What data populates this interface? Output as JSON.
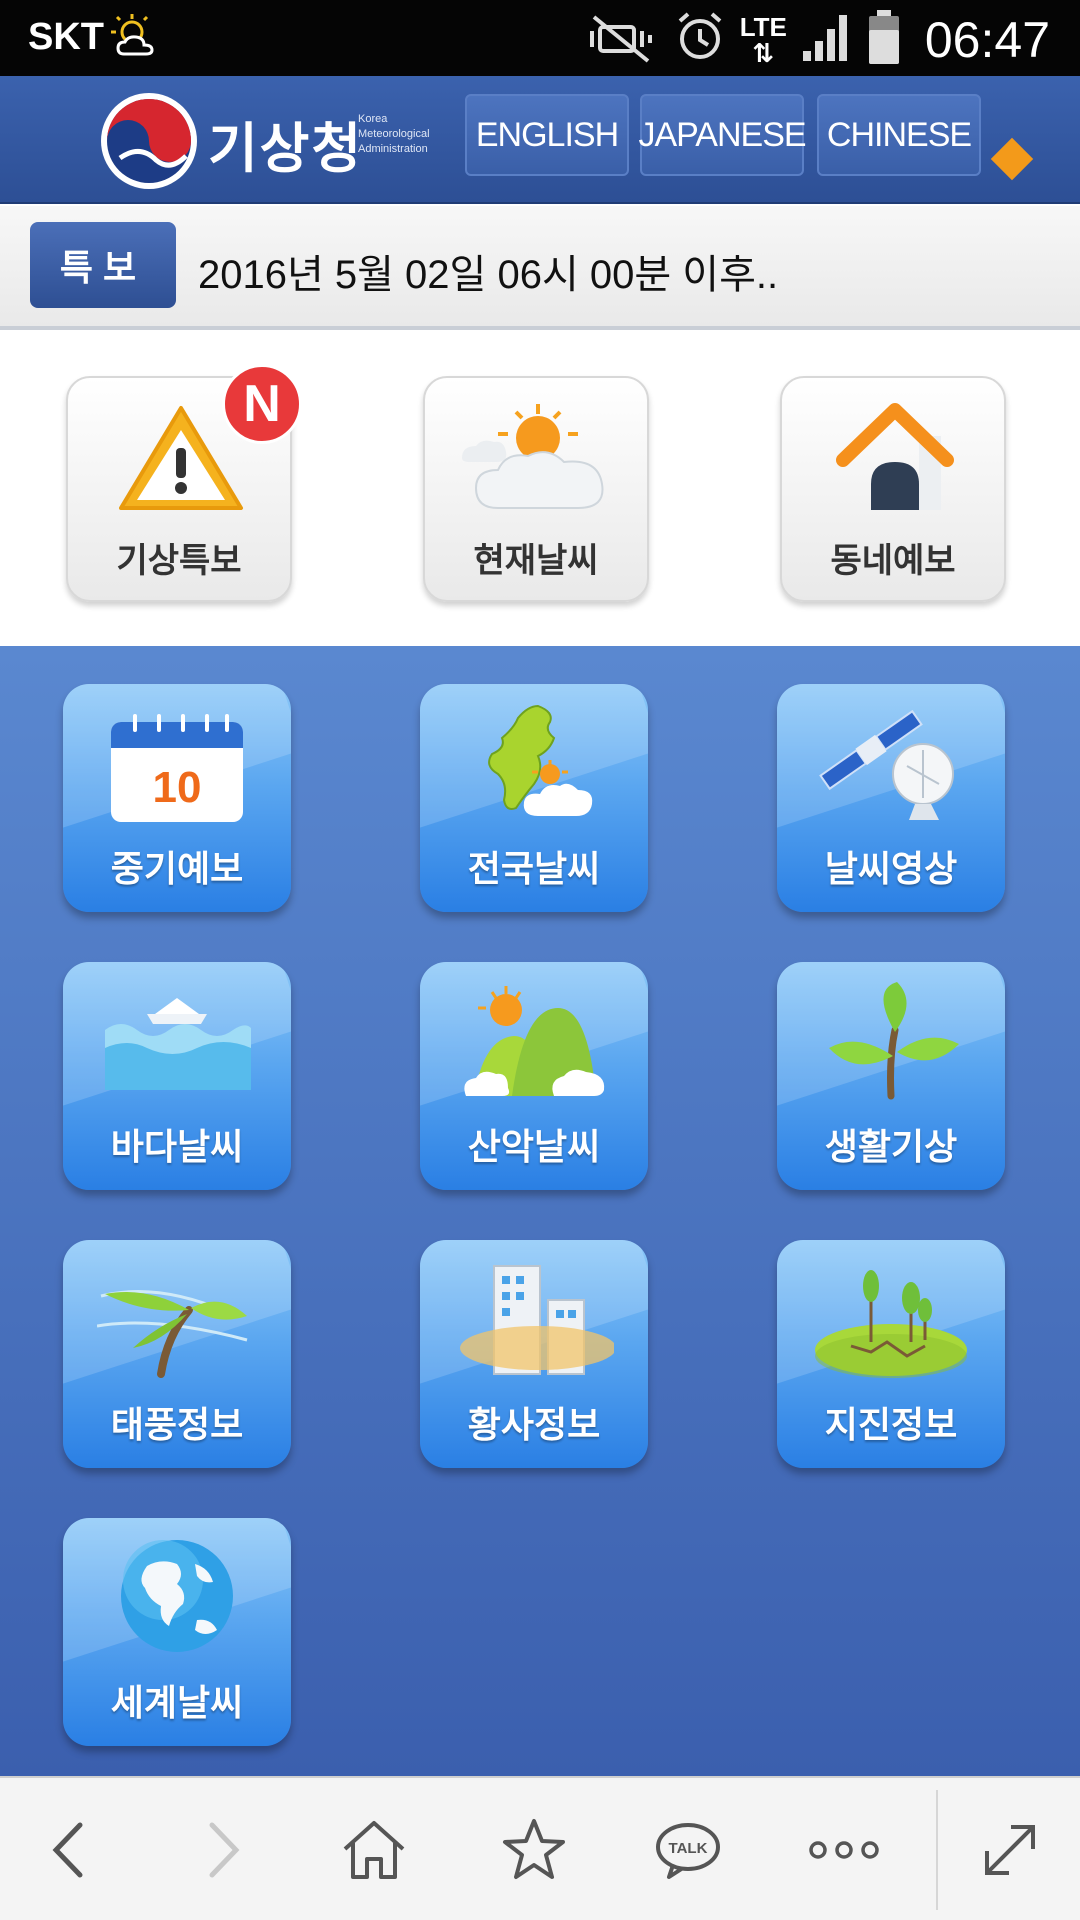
{
  "status_bar": {
    "carrier": "SKT",
    "network": "LTE",
    "time": "06:47"
  },
  "header": {
    "brand": "기상청",
    "brand_sub_lines": [
      "Korea",
      "Meteorological",
      "Administration"
    ],
    "languages": [
      "ENGLISH",
      "JAPANESE",
      "CHINESE"
    ]
  },
  "alert": {
    "badge": "특보",
    "text": "2016년 5월 02일 06시 00분 이후.."
  },
  "top_tiles": [
    {
      "label": "기상특보",
      "icon": "warning-icon"
    },
    {
      "label": "현재날씨",
      "icon": "sun-cloud-icon"
    },
    {
      "label": "동네예보",
      "icon": "house-icon"
    }
  ],
  "new_badge": "N",
  "calendar_day": "10",
  "grid_tiles": [
    {
      "label": "중기예보",
      "icon": "calendar-icon"
    },
    {
      "label": "전국날씨",
      "icon": "korea-map-icon"
    },
    {
      "label": "날씨영상",
      "icon": "satellite-icon"
    },
    {
      "label": "바다날씨",
      "icon": "sea-icon"
    },
    {
      "label": "산악날씨",
      "icon": "mountain-icon"
    },
    {
      "label": "생활기상",
      "icon": "sprout-icon"
    },
    {
      "label": "태풍정보",
      "icon": "typhoon-icon"
    },
    {
      "label": "황사정보",
      "icon": "yellow-dust-icon"
    },
    {
      "label": "지진정보",
      "icon": "earthquake-icon"
    },
    {
      "label": "세계날씨",
      "icon": "globe-icon"
    }
  ],
  "bottom_bar": {
    "talk_label": "TALK",
    "items": [
      "back-icon",
      "forward-icon",
      "home-icon",
      "star-icon",
      "talk-icon",
      "more-icon",
      "expand-icon"
    ]
  },
  "colors": {
    "header_blue": "#2d4f95",
    "tile_blue": "#2a7fe4",
    "badge_red": "#e8393a",
    "accent_orange": "#f39a1a"
  }
}
